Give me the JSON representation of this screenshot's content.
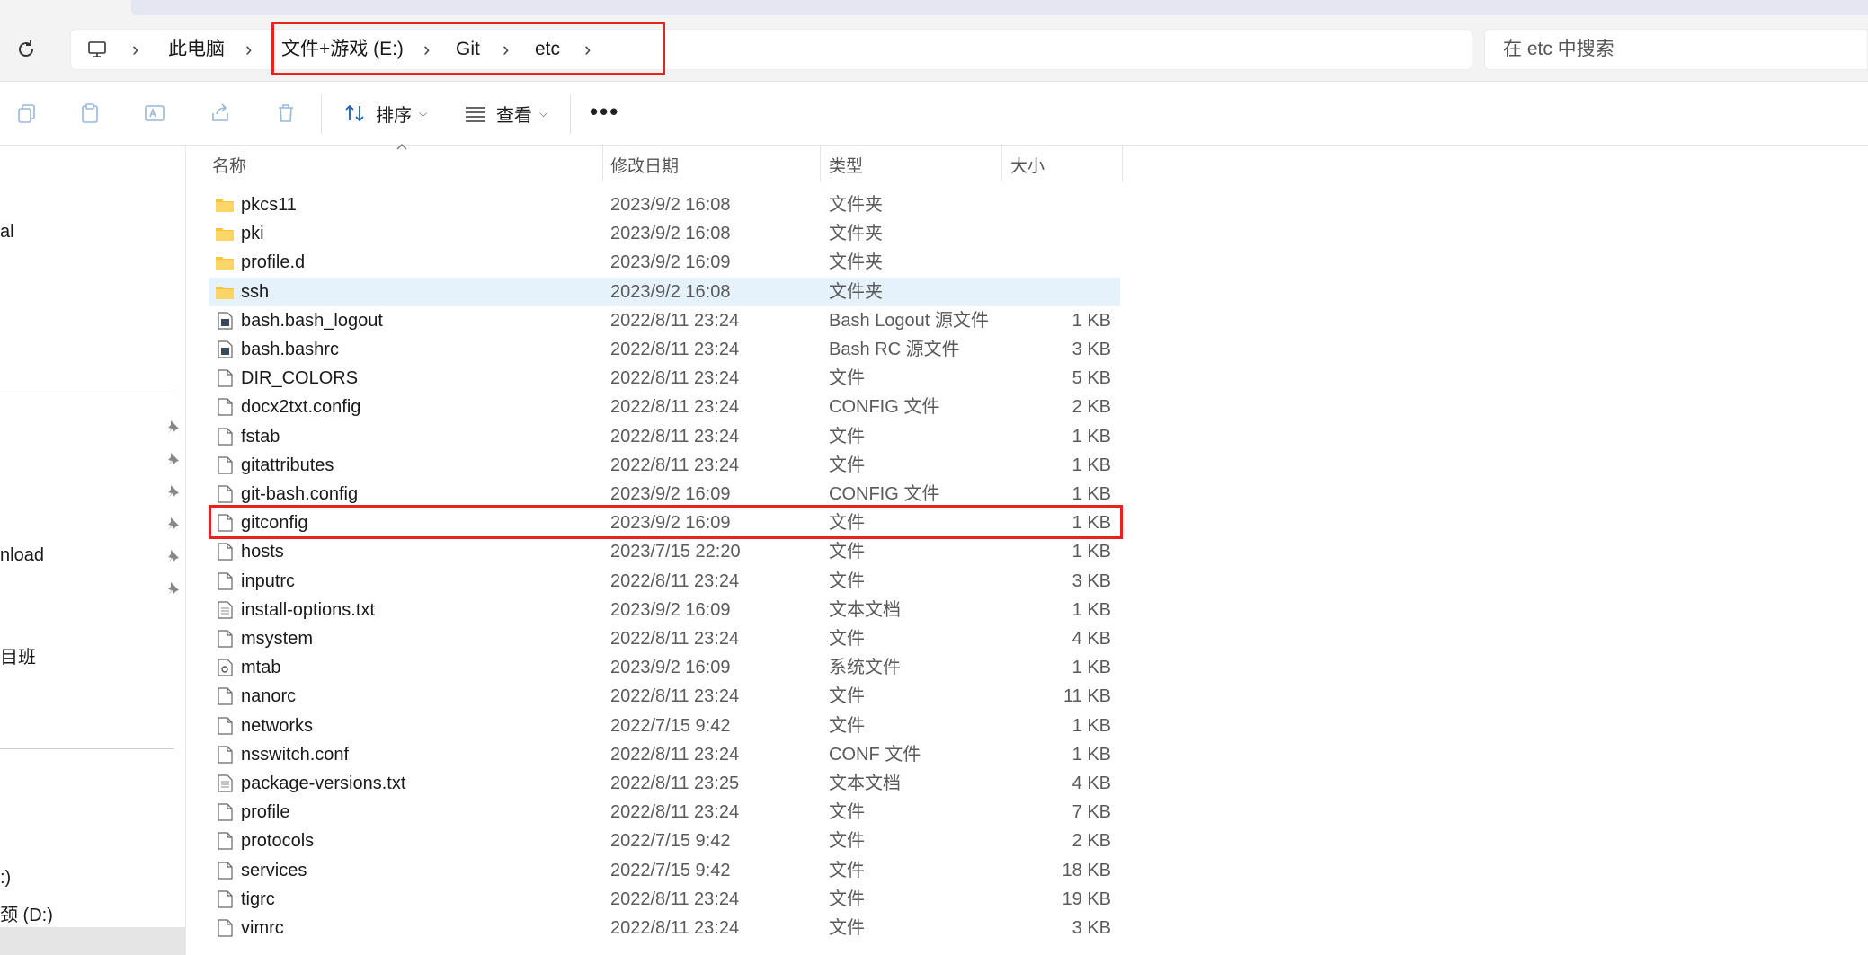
{
  "breadcrumb": {
    "items": [
      "此电脑",
      "文件+游戏 (E:)",
      "Git",
      "etc"
    ]
  },
  "search": {
    "placeholder": "在 etc 中搜索"
  },
  "toolbar": {
    "sort_label": "排序",
    "view_label": "查看",
    "more_label": "•••"
  },
  "columns": {
    "name": "名称",
    "date": "修改日期",
    "type": "类型",
    "size": "大小"
  },
  "sidebar": {
    "items": [
      "al",
      "nload",
      "目班",
      ":)",
      "颈 (D:)"
    ]
  },
  "files": [
    {
      "name": "pkcs11",
      "date": "2023/9/2 16:08",
      "type": "文件夹",
      "size": "",
      "icon": "folder-icon"
    },
    {
      "name": "pki",
      "date": "2023/9/2 16:08",
      "type": "文件夹",
      "size": "",
      "icon": "folder-icon"
    },
    {
      "name": "profile.d",
      "date": "2023/9/2 16:09",
      "type": "文件夹",
      "size": "",
      "icon": "folder-icon"
    },
    {
      "name": "ssh",
      "date": "2023/9/2 16:08",
      "type": "文件夹",
      "size": "",
      "icon": "folder-icon"
    },
    {
      "name": "bash.bash_logout",
      "date": "2022/8/11 23:24",
      "type": "Bash Logout 源文件",
      "size": "1 KB",
      "icon": "script-file-icon"
    },
    {
      "name": "bash.bashrc",
      "date": "2022/8/11 23:24",
      "type": "Bash RC 源文件",
      "size": "3 KB",
      "icon": "script-file-icon"
    },
    {
      "name": "DIR_COLORS",
      "date": "2022/8/11 23:24",
      "type": "文件",
      "size": "5 KB",
      "icon": "file-icon"
    },
    {
      "name": "docx2txt.config",
      "date": "2022/8/11 23:24",
      "type": "CONFIG 文件",
      "size": "2 KB",
      "icon": "file-icon"
    },
    {
      "name": "fstab",
      "date": "2022/8/11 23:24",
      "type": "文件",
      "size": "1 KB",
      "icon": "file-icon"
    },
    {
      "name": "gitattributes",
      "date": "2022/8/11 23:24",
      "type": "文件",
      "size": "1 KB",
      "icon": "file-icon"
    },
    {
      "name": "git-bash.config",
      "date": "2023/9/2 16:09",
      "type": "CONFIG 文件",
      "size": "1 KB",
      "icon": "file-icon"
    },
    {
      "name": "gitconfig",
      "date": "2023/9/2 16:09",
      "type": "文件",
      "size": "1 KB",
      "icon": "file-icon"
    },
    {
      "name": "hosts",
      "date": "2023/7/15 22:20",
      "type": "文件",
      "size": "1 KB",
      "icon": "file-icon"
    },
    {
      "name": "inputrc",
      "date": "2022/8/11 23:24",
      "type": "文件",
      "size": "3 KB",
      "icon": "file-icon"
    },
    {
      "name": "install-options.txt",
      "date": "2023/9/2 16:09",
      "type": "文本文档",
      "size": "1 KB",
      "icon": "text-file-icon"
    },
    {
      "name": "msystem",
      "date": "2022/8/11 23:24",
      "type": "文件",
      "size": "4 KB",
      "icon": "file-icon"
    },
    {
      "name": "mtab",
      "date": "2023/9/2 16:09",
      "type": "系统文件",
      "size": "1 KB",
      "icon": "system-file-icon"
    },
    {
      "name": "nanorc",
      "date": "2022/8/11 23:24",
      "type": "文件",
      "size": "11 KB",
      "icon": "file-icon"
    },
    {
      "name": "networks",
      "date": "2022/7/15 9:42",
      "type": "文件",
      "size": "1 KB",
      "icon": "file-icon"
    },
    {
      "name": "nsswitch.conf",
      "date": "2022/8/11 23:24",
      "type": "CONF 文件",
      "size": "1 KB",
      "icon": "file-icon"
    },
    {
      "name": "package-versions.txt",
      "date": "2022/8/11 23:25",
      "type": "文本文档",
      "size": "4 KB",
      "icon": "text-file-icon"
    },
    {
      "name": "profile",
      "date": "2022/8/11 23:24",
      "type": "文件",
      "size": "7 KB",
      "icon": "file-icon"
    },
    {
      "name": "protocols",
      "date": "2022/7/15 9:42",
      "type": "文件",
      "size": "2 KB",
      "icon": "file-icon"
    },
    {
      "name": "services",
      "date": "2022/7/15 9:42",
      "type": "文件",
      "size": "18 KB",
      "icon": "file-icon"
    },
    {
      "name": "tigrc",
      "date": "2022/8/11 23:24",
      "type": "文件",
      "size": "19 KB",
      "icon": "file-icon"
    },
    {
      "name": "vimrc",
      "date": "2022/8/11 23:24",
      "type": "文件",
      "size": "3 KB",
      "icon": "file-icon"
    }
  ],
  "colors": {
    "highlight": "#e8221d",
    "selected_row": "#e5f1fb",
    "folder": "#f8c43a"
  }
}
